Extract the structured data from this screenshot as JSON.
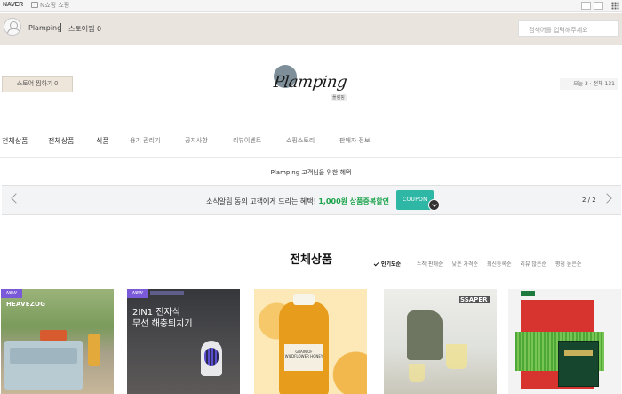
{
  "topbar": {
    "naver_logo": "NAVER",
    "naver_shop": "N쇼핑 쇼핑"
  },
  "store": {
    "name": "Plamping",
    "favorites": "스토어찜 0",
    "search_placeholder": "검색어를 입력해주세요"
  },
  "brand": {
    "logo_text": "Plamping",
    "logo_sub": "플램핑",
    "save_button": "스토어 찜하기 0",
    "visitors": "오늘 3 · 전체 131"
  },
  "nav": {
    "items": [
      "전체상품",
      "전체상품",
      "식품",
      "용기 관리기",
      "공지사항",
      "리뷰이벤트",
      "쇼핑스토리",
      "판매자 정보"
    ]
  },
  "promo": {
    "title": "Plamping 고객님을 위한 혜택",
    "banner_text": "소식알림 동의 고객에게 드리는 혜택! ",
    "banner_highlight": "1,000원 상품중복할인",
    "coupon_label": "COUPON",
    "pager": "2 / 2"
  },
  "section": {
    "title": "전체상품",
    "sort_options": [
      "인기도순",
      "누적 판매순",
      "낮은 가격순",
      "최신등록순",
      "리뷰 많은순",
      "평점 높은순"
    ]
  },
  "products": [
    {
      "badge": "NEW",
      "brand": "HEAVEZOG"
    },
    {
      "badge": "NEW",
      "text_line1": "2IN1 전자식",
      "text_line2": "무선 해충퇴치기"
    },
    {
      "label": "GRAIN OF WILDFLOWER HONEY"
    },
    {
      "logo": "SSAPER"
    },
    {}
  ],
  "colors": {
    "store_bar": "#e9e4de",
    "banner_highlight": "#1aa34a",
    "coupon": "#2fb7a5",
    "badge": "#7a5ad8"
  }
}
